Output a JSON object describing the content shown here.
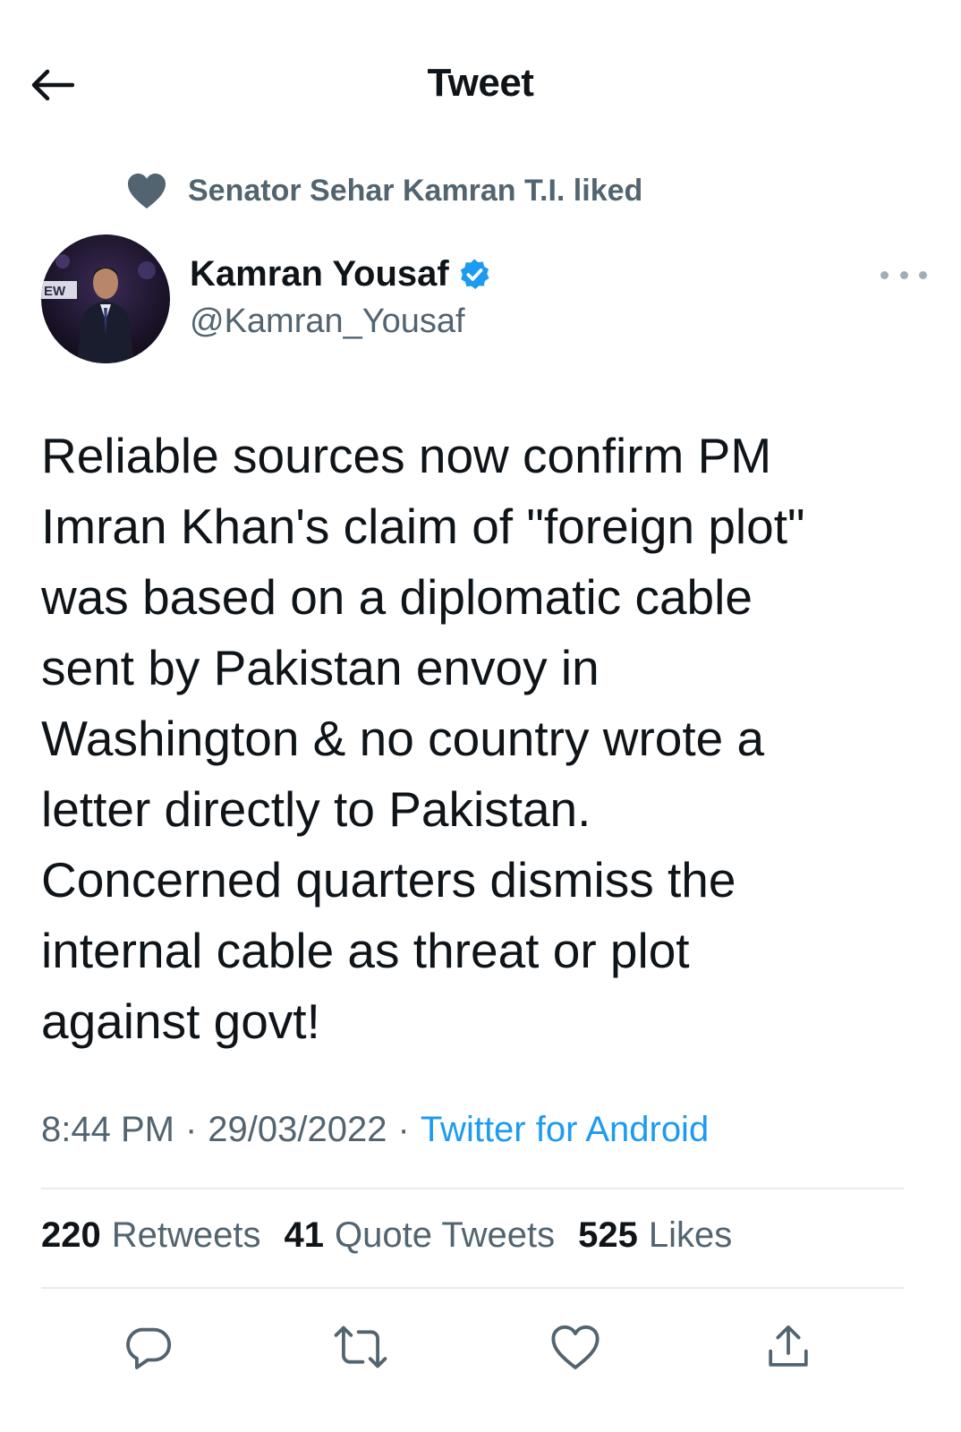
{
  "header": {
    "title": "Tweet",
    "back_icon": "arrow-left-icon"
  },
  "social_context": {
    "text": "Senator Sehar Kamran T.I. liked",
    "icon": "heart-filled-icon"
  },
  "author": {
    "name": "Kamran Yousaf",
    "handle": "@Kamran_Yousaf",
    "verified": true,
    "avatar_tag": "EW"
  },
  "tweet": {
    "text": "Reliable sources now confirm PM\nImran Khan's claim of \"foreign plot\"\nwas based on a diplomatic cable\nsent by Pakistan envoy in\nWashington & no country wrote a\nletter directly to Pakistan.\nConcerned quarters dismiss the\ninternal cable as threat or plot\nagainst govt!",
    "time": "8:44 PM",
    "date": "29/03/2022",
    "source": "Twitter for Android",
    "separator": "·"
  },
  "stats": {
    "retweets": {
      "count": "220",
      "label": "Retweets"
    },
    "quotes": {
      "count": "41",
      "label": "Quote Tweets"
    },
    "likes": {
      "count": "525",
      "label": "Likes"
    }
  },
  "actions": [
    "reply-icon",
    "retweet-icon",
    "like-icon",
    "share-icon"
  ],
  "colors": {
    "accent": "#1d9bf0",
    "secondary_text": "#536471",
    "primary_text": "#0f1419",
    "divider": "#e6ecf0"
  }
}
